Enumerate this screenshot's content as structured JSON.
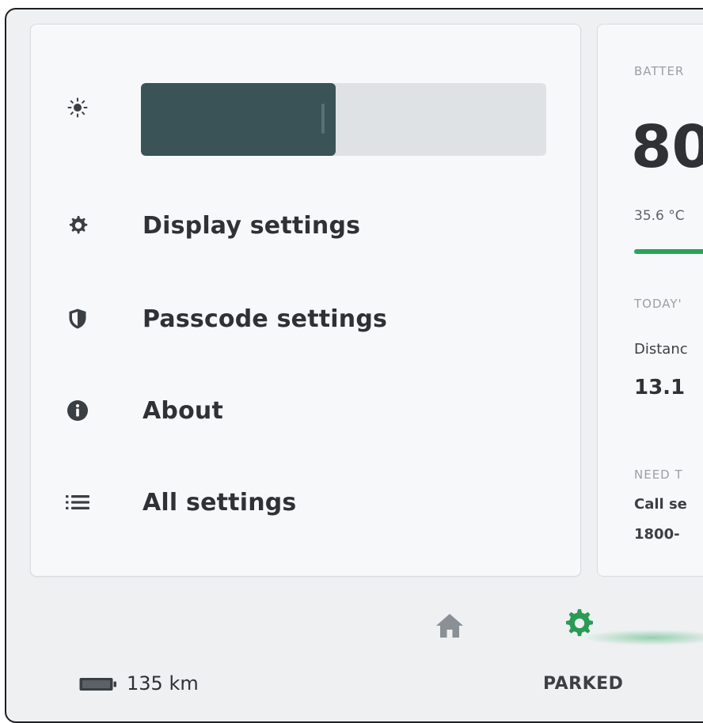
{
  "quick_settings": {
    "brightness": {
      "level_percent": 48
    },
    "items": [
      {
        "label": "Display settings",
        "icon": "gear-icon"
      },
      {
        "label": "Passcode settings",
        "icon": "shield-icon"
      },
      {
        "label": "About",
        "icon": "info-icon"
      },
      {
        "label": "All settings",
        "icon": "list-icon"
      }
    ]
  },
  "info_panel": {
    "battery_label": "BATTER",
    "battery_value": "80",
    "temperature": "35.6 °C",
    "today_label": "TODAY'",
    "distance_label": "Distanc",
    "distance_value": "13.1",
    "help_label": "NEED T",
    "call_label": "Call se",
    "phone": "1800-"
  },
  "nav": {
    "home_icon": "home-icon",
    "settings_icon": "gear-icon",
    "active_tab": "settings"
  },
  "status": {
    "range": "135 km",
    "drive_state": "PARKED"
  },
  "colors": {
    "slider_fill": "#3a5357",
    "accent_green": "#29a35a",
    "text": "#2f3135"
  }
}
